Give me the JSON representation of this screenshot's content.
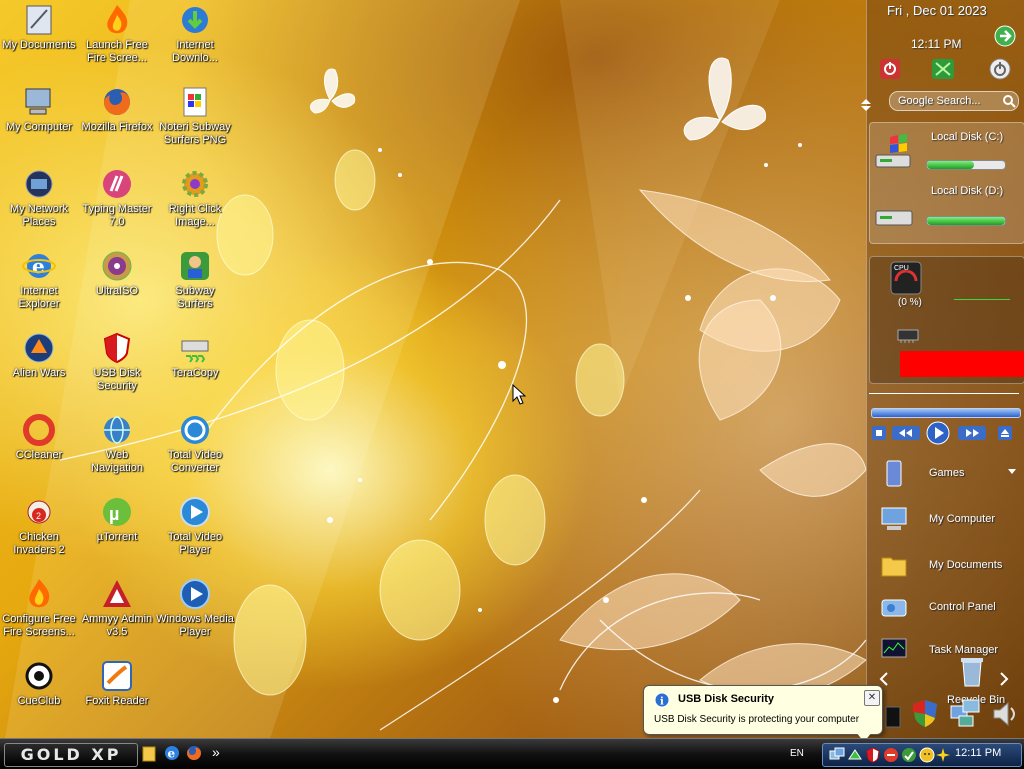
{
  "desktop": {
    "icons": [
      {
        "label": "My Documents"
      },
      {
        "label": "Launch Free\nFire Scree..."
      },
      {
        "label": "Internet\nDownlo..."
      },
      {
        "label": "My Computer"
      },
      {
        "label": "Mozilla Firefox"
      },
      {
        "label": "Noteri Subway\nSurfers PNG"
      },
      {
        "label": "My Network\nPlaces"
      },
      {
        "label": "Typing Master\n7.0"
      },
      {
        "label": "Right Click\nImage..."
      },
      {
        "label": "Internet\nExplorer"
      },
      {
        "label": "UltraISO"
      },
      {
        "label": "Subway\nSurfers"
      },
      {
        "label": "Alien Wars"
      },
      {
        "label": "USB Disk\nSecurity"
      },
      {
        "label": "TeraCopy"
      },
      {
        "label": "CCleaner"
      },
      {
        "label": "Web\nNavigation"
      },
      {
        "label": "Total Video\nConverter"
      },
      {
        "label": "Chicken\nInvaders 2"
      },
      {
        "label": "µTorrent"
      },
      {
        "label": "Total Video\nPlayer"
      },
      {
        "label": "Configure Free\nFire Screens..."
      },
      {
        "label": "Ammyy Admin\nv3.5"
      },
      {
        "label": "Windows Media\nPlayer"
      },
      {
        "label": "CueClub"
      },
      {
        "label": "Foxit Reader"
      }
    ]
  },
  "sidebar": {
    "date": "Fri , Dec 01 2023",
    "time": "12:11 PM",
    "search_placeholder": "Google Search...",
    "drives": [
      {
        "label": "Local Disk (C:)",
        "used_fraction": 0.6
      },
      {
        "label": "Local Disk (D:)",
        "used_fraction": 1.0
      }
    ],
    "cpu_label": "CPU",
    "cpu_percent": "(0 %)",
    "items": [
      {
        "label": "Games"
      },
      {
        "label": "My Computer"
      },
      {
        "label": "My Documents"
      },
      {
        "label": "Control Panel"
      },
      {
        "label": "Task Manager"
      },
      {
        "label": "Recycle Bin"
      }
    ]
  },
  "taskbar": {
    "start_label": "GOLD XP",
    "overflow_label": "»",
    "language": "EN",
    "clock": "12:11 PM"
  },
  "balloon": {
    "title": "USB Disk Security",
    "message": "USB Disk Security is protecting your computer",
    "close_label": "✕"
  },
  "colors": {
    "balloon_bg": "#ffffe1",
    "cpu_bar": "#ff0000",
    "taskbar_tray": "#1a3766"
  }
}
